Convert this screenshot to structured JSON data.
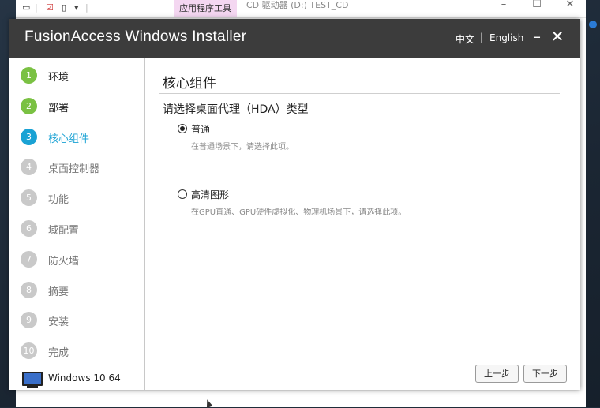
{
  "explorer": {
    "ribbon_tab": "应用程序工具",
    "title": "CD 驱动器 (D:) TEST_CD",
    "quick_access": "▾"
  },
  "installer": {
    "title": "FusionAccess Windows Installer",
    "lang_zh": "中文",
    "lang_sep": "|",
    "lang_en": "English"
  },
  "steps": [
    {
      "num": "1",
      "label": "环境",
      "state": "done"
    },
    {
      "num": "2",
      "label": "部署",
      "state": "done"
    },
    {
      "num": "3",
      "label": "核心组件",
      "state": "active"
    },
    {
      "num": "4",
      "label": "桌面控制器",
      "state": "pending"
    },
    {
      "num": "5",
      "label": "功能",
      "state": "pending"
    },
    {
      "num": "6",
      "label": "域配置",
      "state": "pending"
    },
    {
      "num": "7",
      "label": "防火墙",
      "state": "pending"
    },
    {
      "num": "8",
      "label": "摘要",
      "state": "pending"
    },
    {
      "num": "9",
      "label": "安装",
      "state": "pending"
    },
    {
      "num": "10",
      "label": "完成",
      "state": "pending"
    }
  ],
  "colors": {
    "done": "#7ac143",
    "active": "#1aa2d4",
    "pending": "#c9c9c9",
    "done_text": "#222222",
    "active_text": "#1aa2d4",
    "pending_text": "#777777"
  },
  "os_label": "Windows 10 64",
  "main": {
    "section_title": "核心组件",
    "question": "请选择桌面代理（HDA）类型",
    "options": [
      {
        "label": "普通",
        "desc": "在普通场景下，请选择此项。",
        "selected": true
      },
      {
        "label": "高清图形",
        "desc": "在GPU直通、GPU硬件虚拟化、物理机场景下，请选择此项。",
        "selected": false
      }
    ],
    "prev_button": "上一步",
    "next_button": "下一步"
  }
}
